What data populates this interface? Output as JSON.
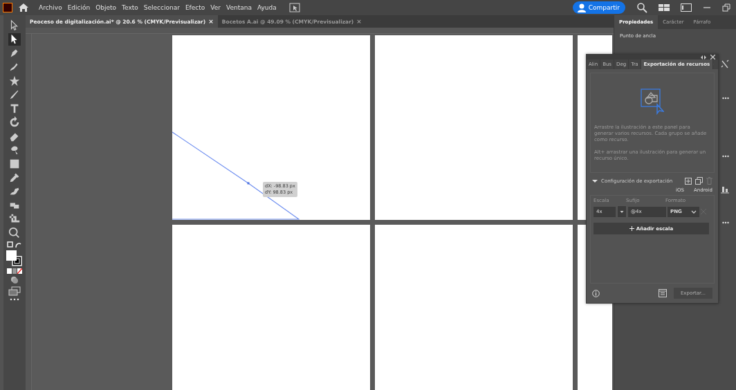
{
  "menu_bar": {
    "items": [
      "Archivo",
      "Edición",
      "Objeto",
      "Texto",
      "Seleccionar",
      "Efecto",
      "Ver",
      "Ventana",
      "Ayuda"
    ],
    "share_button": "Compartir"
  },
  "document_tabs": [
    {
      "label": "Peoceso de digitalización.ai* @ 20.6 % (CMYK/Previsualizar)",
      "close": "×",
      "selected": true
    },
    {
      "label": "Bocetos A.ai @ 49.09 % (CMYK/Previsualizar)",
      "close": "×",
      "selected": false
    }
  ],
  "tools": [
    {
      "kind": "selection",
      "selected": false
    },
    {
      "kind": "direct-selection",
      "selected": true
    },
    {
      "kind": "pen",
      "selected": false
    },
    {
      "kind": "curvature",
      "selected": false
    },
    {
      "kind": "star",
      "selected": false
    },
    {
      "kind": "brush",
      "selected": false
    },
    {
      "kind": "type",
      "selected": false
    },
    {
      "kind": "rotate",
      "selected": false
    },
    {
      "kind": "eraser",
      "selected": false
    },
    {
      "kind": "lasso",
      "selected": false
    },
    {
      "kind": "gradient",
      "selected": false
    },
    {
      "kind": "eyedropper",
      "selected": false
    },
    {
      "kind": "puppet",
      "selected": false
    },
    {
      "kind": "blend",
      "selected": false
    },
    {
      "kind": "crop",
      "selected": false
    },
    {
      "kind": "zoom",
      "selected": false
    }
  ],
  "measure_tooltip": [
    "dX: -98.83 px",
    "dY: 98.83 px"
  ],
  "properties_panel": {
    "tabs": [
      {
        "label": "Propiedades",
        "selected": true
      },
      {
        "label": "Carácter",
        "selected": false
      },
      {
        "label": "Párrafo",
        "selected": false
      }
    ],
    "section_title": "Punto de ancla"
  },
  "export_panel": {
    "tabs": [
      {
        "label": "Alin",
        "selected": false
      },
      {
        "label": "Bus",
        "selected": false
      },
      {
        "label": "Deg",
        "selected": false
      },
      {
        "label": "Tra",
        "selected": false
      },
      {
        "label": "Exportación de recursos",
        "selected": true
      }
    ],
    "description": [
      "Arrastre la ilustración a este panel para generar varios recursos. Cada grupo se añade como recurso.",
      "Alt+ arrastrar una ilustración para generar un recurso único."
    ],
    "settings_title": "Configuración de exportación",
    "platforms": [
      "iOS",
      "Android"
    ],
    "columns": [
      "Escala",
      "Sufijo",
      "Formato"
    ],
    "scale": "4x",
    "suffix": "@4x",
    "format": "PNG",
    "add_button": "Añadir escala",
    "export_button": {
      "label": "Exportar...",
      "disabled": true
    }
  }
}
